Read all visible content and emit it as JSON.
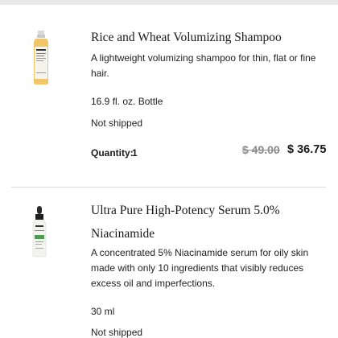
{
  "cart": {
    "items": [
      {
        "title": "Rice and Wheat Volumizing Shampoo",
        "description": "A lightweight volumizing shampoo for thin, flat or fine hair.",
        "size": "16.9 fl. oz. Bottle",
        "status": "Not shipped",
        "quantity_label": "Quantity:",
        "quantity": "1",
        "price_original": "$ 49.00",
        "price_sale": "$ 36.75",
        "image_icon": "shampoo-bottle-icon"
      },
      {
        "title_line1": "Ultra Pure High-Potency Serum 5.0%",
        "title_line2": "Niacinamide",
        "description": "A concentrated 5% Niacinamide serum for oily skin made with only 10 ingredients that visibly reduces excess oil and imperfections.",
        "size": "30 ml",
        "status": "Not shipped",
        "image_icon": "serum-dropper-bottle-icon"
      }
    ]
  },
  "colors": {
    "text": "#1a1a1a",
    "strike": "#8a8a8a",
    "divider": "#dcdcdc",
    "bottle_label_green": "#4f9a55"
  }
}
